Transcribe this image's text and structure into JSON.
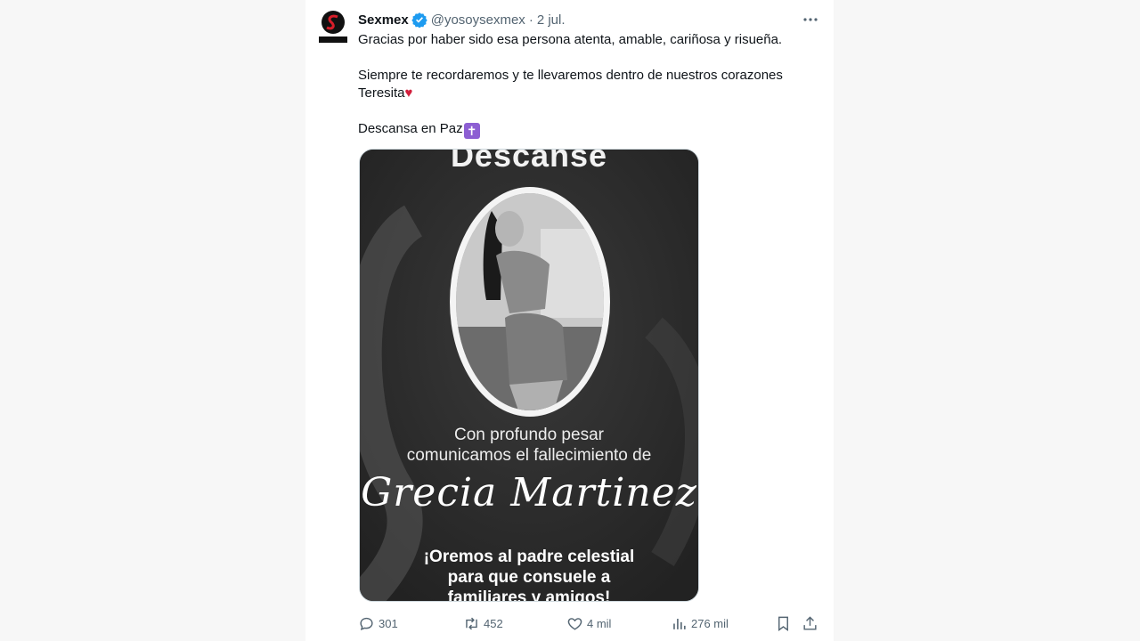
{
  "tweet": {
    "author_name": "Sexmex",
    "handle": "@yosoysexmex",
    "separator": "·",
    "date": "2 jul.",
    "avatar_text": "SEXMEX",
    "more_icon": "more-horizontal-icon",
    "verified_icon": "verified-badge-icon",
    "text": {
      "line1": "Gracias por haber sido esa persona atenta, amable, cariñosa y risueña.",
      "line2": "Siempre te recordaremos y te llevaremos dentro de nuestros corazones",
      "line3": "Teresita",
      "heart": "♥",
      "line4": "Descansa en Paz",
      "cross": "✝"
    },
    "media": {
      "title": "Descanse",
      "line1": "Con profundo pesar",
      "line2": "comunicamos el fallecimiento de",
      "name": "Grecia Martinez",
      "pray1": "¡Oremos al padre celestial",
      "pray2": "para que consuele a",
      "pray3": "familiares y amigos!"
    },
    "actions": {
      "replies": "301",
      "reposts": "452",
      "likes": "4 mil",
      "views": "276 mil"
    },
    "colors": {
      "verified": "#1d9bf0",
      "muted": "#536471",
      "heart": "#d21f3c"
    }
  }
}
